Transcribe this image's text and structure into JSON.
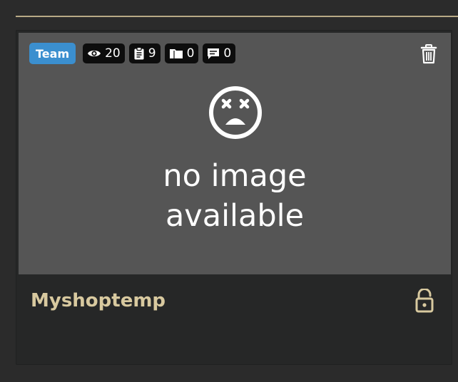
{
  "card": {
    "badge": "Team",
    "stats": {
      "views": "20",
      "pages": "9",
      "folders": "0",
      "comments": "0"
    },
    "placeholder": {
      "line1": "no image",
      "line2": "available"
    },
    "title": "Myshoptemp"
  },
  "icons": {
    "views": "eye-icon",
    "pages": "clipboard-icon",
    "folders": "folder-icon",
    "comments": "comment-icon",
    "delete": "trash-icon",
    "lock": "lock-open-icon",
    "placeholder": "dizzy-face-icon"
  },
  "colors": {
    "page_background": "#2b2b2b",
    "card_background": "#262727",
    "thumbnail_background": "#555555",
    "badge_background": "#3b8fcf",
    "stat_background": "#0d0d0d",
    "accent_gold": "#d8c99f",
    "divider": "#b8aa86"
  }
}
